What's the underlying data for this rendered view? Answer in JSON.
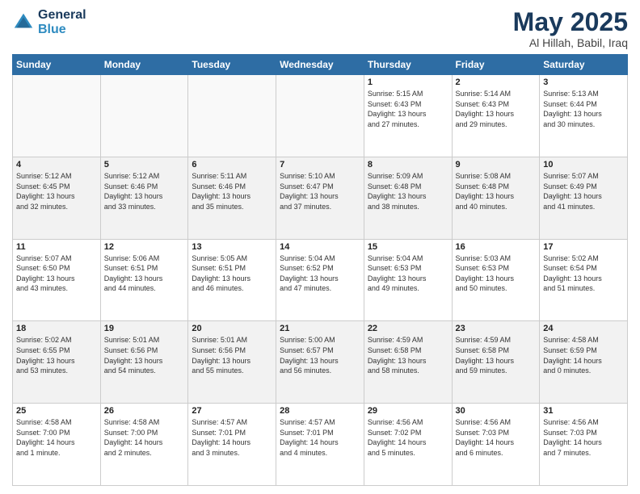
{
  "header": {
    "logo_line1": "General",
    "logo_line2": "Blue",
    "title": "May 2025",
    "subtitle": "Al Hillah, Babil, Iraq"
  },
  "weekdays": [
    "Sunday",
    "Monday",
    "Tuesday",
    "Wednesday",
    "Thursday",
    "Friday",
    "Saturday"
  ],
  "weeks": [
    [
      {
        "day": "",
        "info": ""
      },
      {
        "day": "",
        "info": ""
      },
      {
        "day": "",
        "info": ""
      },
      {
        "day": "",
        "info": ""
      },
      {
        "day": "1",
        "info": "Sunrise: 5:15 AM\nSunset: 6:43 PM\nDaylight: 13 hours\nand 27 minutes."
      },
      {
        "day": "2",
        "info": "Sunrise: 5:14 AM\nSunset: 6:43 PM\nDaylight: 13 hours\nand 29 minutes."
      },
      {
        "day": "3",
        "info": "Sunrise: 5:13 AM\nSunset: 6:44 PM\nDaylight: 13 hours\nand 30 minutes."
      }
    ],
    [
      {
        "day": "4",
        "info": "Sunrise: 5:12 AM\nSunset: 6:45 PM\nDaylight: 13 hours\nand 32 minutes."
      },
      {
        "day": "5",
        "info": "Sunrise: 5:12 AM\nSunset: 6:46 PM\nDaylight: 13 hours\nand 33 minutes."
      },
      {
        "day": "6",
        "info": "Sunrise: 5:11 AM\nSunset: 6:46 PM\nDaylight: 13 hours\nand 35 minutes."
      },
      {
        "day": "7",
        "info": "Sunrise: 5:10 AM\nSunset: 6:47 PM\nDaylight: 13 hours\nand 37 minutes."
      },
      {
        "day": "8",
        "info": "Sunrise: 5:09 AM\nSunset: 6:48 PM\nDaylight: 13 hours\nand 38 minutes."
      },
      {
        "day": "9",
        "info": "Sunrise: 5:08 AM\nSunset: 6:48 PM\nDaylight: 13 hours\nand 40 minutes."
      },
      {
        "day": "10",
        "info": "Sunrise: 5:07 AM\nSunset: 6:49 PM\nDaylight: 13 hours\nand 41 minutes."
      }
    ],
    [
      {
        "day": "11",
        "info": "Sunrise: 5:07 AM\nSunset: 6:50 PM\nDaylight: 13 hours\nand 43 minutes."
      },
      {
        "day": "12",
        "info": "Sunrise: 5:06 AM\nSunset: 6:51 PM\nDaylight: 13 hours\nand 44 minutes."
      },
      {
        "day": "13",
        "info": "Sunrise: 5:05 AM\nSunset: 6:51 PM\nDaylight: 13 hours\nand 46 minutes."
      },
      {
        "day": "14",
        "info": "Sunrise: 5:04 AM\nSunset: 6:52 PM\nDaylight: 13 hours\nand 47 minutes."
      },
      {
        "day": "15",
        "info": "Sunrise: 5:04 AM\nSunset: 6:53 PM\nDaylight: 13 hours\nand 49 minutes."
      },
      {
        "day": "16",
        "info": "Sunrise: 5:03 AM\nSunset: 6:53 PM\nDaylight: 13 hours\nand 50 minutes."
      },
      {
        "day": "17",
        "info": "Sunrise: 5:02 AM\nSunset: 6:54 PM\nDaylight: 13 hours\nand 51 minutes."
      }
    ],
    [
      {
        "day": "18",
        "info": "Sunrise: 5:02 AM\nSunset: 6:55 PM\nDaylight: 13 hours\nand 53 minutes."
      },
      {
        "day": "19",
        "info": "Sunrise: 5:01 AM\nSunset: 6:56 PM\nDaylight: 13 hours\nand 54 minutes."
      },
      {
        "day": "20",
        "info": "Sunrise: 5:01 AM\nSunset: 6:56 PM\nDaylight: 13 hours\nand 55 minutes."
      },
      {
        "day": "21",
        "info": "Sunrise: 5:00 AM\nSunset: 6:57 PM\nDaylight: 13 hours\nand 56 minutes."
      },
      {
        "day": "22",
        "info": "Sunrise: 4:59 AM\nSunset: 6:58 PM\nDaylight: 13 hours\nand 58 minutes."
      },
      {
        "day": "23",
        "info": "Sunrise: 4:59 AM\nSunset: 6:58 PM\nDaylight: 13 hours\nand 59 minutes."
      },
      {
        "day": "24",
        "info": "Sunrise: 4:58 AM\nSunset: 6:59 PM\nDaylight: 14 hours\nand 0 minutes."
      }
    ],
    [
      {
        "day": "25",
        "info": "Sunrise: 4:58 AM\nSunset: 7:00 PM\nDaylight: 14 hours\nand 1 minute."
      },
      {
        "day": "26",
        "info": "Sunrise: 4:58 AM\nSunset: 7:00 PM\nDaylight: 14 hours\nand 2 minutes."
      },
      {
        "day": "27",
        "info": "Sunrise: 4:57 AM\nSunset: 7:01 PM\nDaylight: 14 hours\nand 3 minutes."
      },
      {
        "day": "28",
        "info": "Sunrise: 4:57 AM\nSunset: 7:01 PM\nDaylight: 14 hours\nand 4 minutes."
      },
      {
        "day": "29",
        "info": "Sunrise: 4:56 AM\nSunset: 7:02 PM\nDaylight: 14 hours\nand 5 minutes."
      },
      {
        "day": "30",
        "info": "Sunrise: 4:56 AM\nSunset: 7:03 PM\nDaylight: 14 hours\nand 6 minutes."
      },
      {
        "day": "31",
        "info": "Sunrise: 4:56 AM\nSunset: 7:03 PM\nDaylight: 14 hours\nand 7 minutes."
      }
    ]
  ]
}
